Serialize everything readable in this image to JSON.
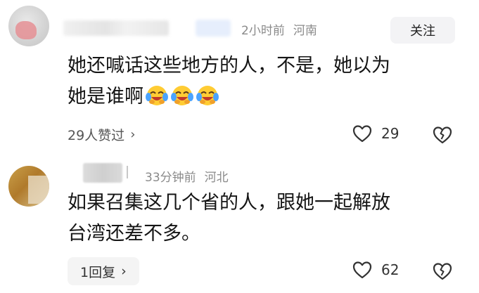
{
  "comments": [
    {
      "time": "2小时前",
      "location": "河南",
      "follow_label": "关注",
      "text_line1": "她还喊话这些地方的人，不是，她以为",
      "text_line2": "她是谁啊",
      "emoji": "laugh-cry-emoji",
      "likers_label": "29人赞过",
      "like_count": "29"
    },
    {
      "time": "33分钟前",
      "location": "河北",
      "text_line1": "如果召集这几个省的人，跟她一起解放",
      "text_line2": "台湾还差不多。",
      "reply_label": "1回复",
      "like_count": "62"
    }
  ],
  "icons": {
    "chevron": "›",
    "like": "heart-outline-icon",
    "dislike": "broken-heart-icon"
  },
  "colors": {
    "meta": "#8a8a8a",
    "button_bg": "#f3f3f5"
  }
}
